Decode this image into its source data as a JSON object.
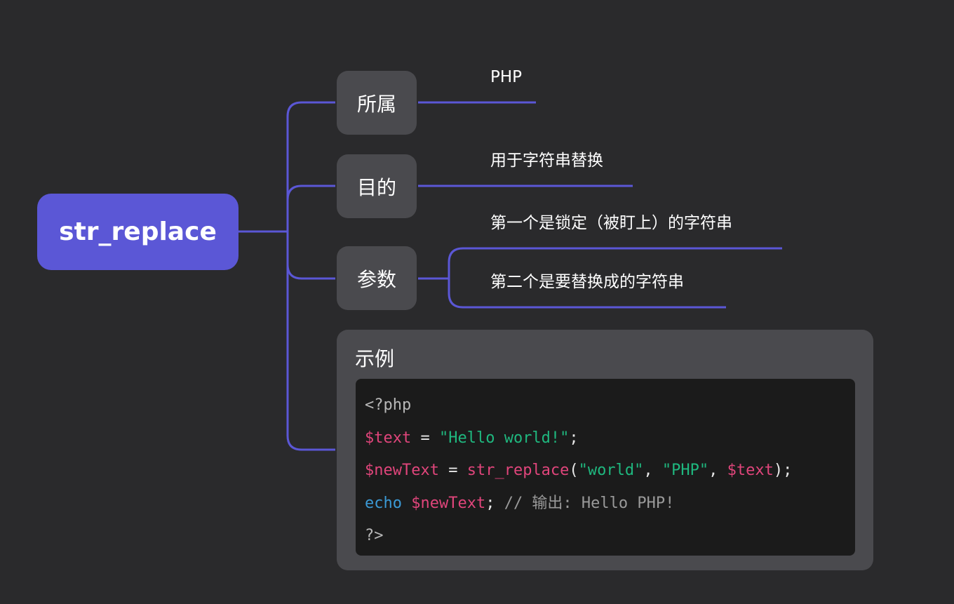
{
  "root": {
    "label": "str_replace"
  },
  "branches": {
    "belongs": {
      "label": "所属",
      "value": "PHP"
    },
    "purpose": {
      "label": "目的",
      "value": "用于字符串替换"
    },
    "params": {
      "label": "参数",
      "items": [
        "第一个是锁定（被盯上）的字符串",
        "第二个是要替换成的字符串"
      ]
    },
    "example": {
      "label": "示例",
      "code": {
        "line1": {
          "tag": "<?php"
        },
        "line2": {
          "var": "$text",
          "op": " = ",
          "str": "\"Hello world!\"",
          "end": ";"
        },
        "line3": {
          "var": "$newText",
          "op": " = ",
          "fn": "str_replace",
          "open": "(",
          "arg1": "\"world\"",
          "sep1": ", ",
          "arg2": "\"PHP\"",
          "sep2": ", ",
          "arg3": "$text",
          "close": ");"
        },
        "line4": {
          "kw": "echo",
          "sp": " ",
          "var": "$newText",
          "end": ";",
          "comment": " // 输出: Hello PHP!"
        },
        "line5": {
          "tag": "?>"
        }
      }
    }
  },
  "colors": {
    "background": "#2a2a2c",
    "root_fill": "#5b57d6",
    "node_fill": "#4a4a4e",
    "connector": "#5b57d6",
    "code_bg": "#1b1b1b",
    "code_variable": "#e0457b",
    "code_string": "#1fb87f",
    "code_keyword": "#3b9ad6",
    "code_comment": "#9a9a9a"
  }
}
